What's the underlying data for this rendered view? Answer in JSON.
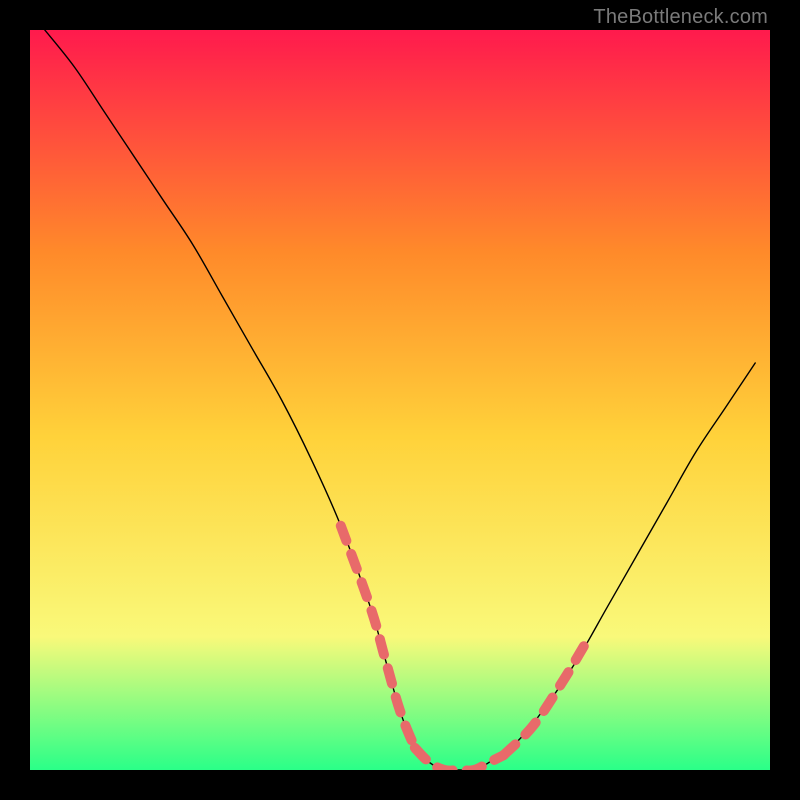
{
  "watermark": "TheBottleneck.com",
  "chart_data": {
    "type": "line",
    "title": "",
    "xlabel": "",
    "ylabel": "",
    "xlim": [
      0,
      100
    ],
    "ylim": [
      0,
      100
    ],
    "grid": false,
    "legend": false,
    "background_gradient": {
      "top": "#ff1a4d",
      "upper_mid": "#ff8a2a",
      "mid": "#ffd23a",
      "lower_mid": "#f9f97a",
      "bottom": "#2aff88"
    },
    "series": [
      {
        "name": "bottleneck-curve",
        "style": "solid-black",
        "x": [
          2,
          6,
          10,
          14,
          18,
          22,
          26,
          30,
          34,
          38,
          42,
          46,
          48,
          50,
          52,
          54,
          56,
          58,
          60,
          62,
          66,
          70,
          74,
          78,
          82,
          86,
          90,
          94,
          98
        ],
        "y": [
          100,
          95,
          89,
          83,
          77,
          71,
          64,
          57,
          50,
          42,
          33,
          22,
          15,
          8,
          3,
          1,
          0,
          0,
          0,
          1,
          4,
          9,
          15,
          22,
          29,
          36,
          43,
          49,
          55
        ]
      },
      {
        "name": "optimal-band-left",
        "style": "coral-dash",
        "x": [
          42,
          46,
          48,
          50,
          52
        ],
        "y": [
          33,
          22,
          15,
          8,
          3
        ]
      },
      {
        "name": "optimal-band-bottom",
        "style": "coral-dash",
        "x": [
          52,
          54,
          56,
          58,
          60,
          62,
          64
        ],
        "y": [
          3,
          1,
          0,
          0,
          0,
          1,
          2
        ]
      },
      {
        "name": "optimal-band-right",
        "style": "coral-dash",
        "x": [
          64,
          68,
          72,
          75
        ],
        "y": [
          2,
          6,
          12,
          17
        ]
      }
    ]
  }
}
